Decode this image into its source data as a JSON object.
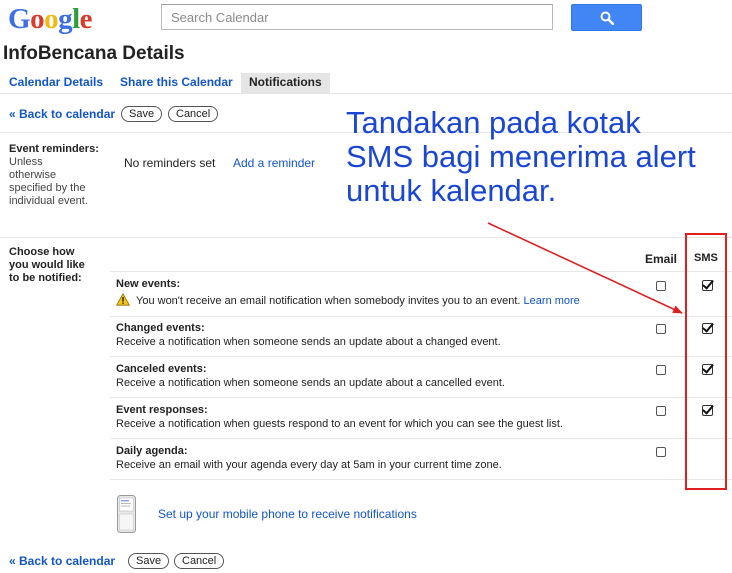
{
  "header": {
    "logo_text": "Google",
    "logo_colors": [
      "#3b6ee8",
      "#dc3a2a",
      "#f2b90f",
      "#3b6ee8",
      "#2d9e3d",
      "#dc3a2a"
    ],
    "search_placeholder": "Search Calendar",
    "search_button_icon": "search-icon",
    "accent": "#4285f4"
  },
  "page_title": "InfoBencana Details",
  "tabs": [
    {
      "label": "Calendar Details",
      "active": false
    },
    {
      "label": "Share this Calendar",
      "active": false
    },
    {
      "label": "Notifications",
      "active": true
    }
  ],
  "nav": {
    "back_label": "« Back to calendar",
    "save_label": "Save",
    "cancel_label": "Cancel"
  },
  "reminders": {
    "label": "Event reminders:",
    "sub": [
      "Unless",
      "otherwise",
      "specified by the",
      "individual event."
    ],
    "value": "No reminders set",
    "add_link": "Add a reminder"
  },
  "notify": {
    "label": [
      "Choose how",
      "you would like",
      "to be notified:"
    ],
    "col_email": "Email",
    "col_sms": "SMS",
    "rows": [
      {
        "title": "New events:",
        "desc": "You won't receive an email notification when somebody invites you to an event.",
        "link": "Learn more",
        "warning": true,
        "email": false,
        "sms": true
      },
      {
        "title": "Changed events:",
        "desc": "Receive a notification when someone sends an update about a changed event.",
        "email": false,
        "sms": true
      },
      {
        "title": "Canceled events:",
        "desc": "Receive a notification when someone sends an update about a cancelled event.",
        "email": false,
        "sms": true
      },
      {
        "title": "Event responses:",
        "desc": "Receive a notification when guests respond to an event for which you can see the guest list.",
        "email": false,
        "sms": true
      },
      {
        "title": "Daily agenda:",
        "desc": "Receive an email with your agenda every day at 5am in your current time zone.",
        "email": false,
        "sms": null
      }
    ],
    "mobile_link": "Set up your mobile phone to receive notifications",
    "mobile_icon": "mobile-phone-icon"
  },
  "annotation": {
    "lines": [
      "Tandakan pada kotak",
      "SMS bagi menerima alert",
      "untuk kalendar."
    ],
    "color": "#1a46d6",
    "highlight_color": "#e02020"
  }
}
